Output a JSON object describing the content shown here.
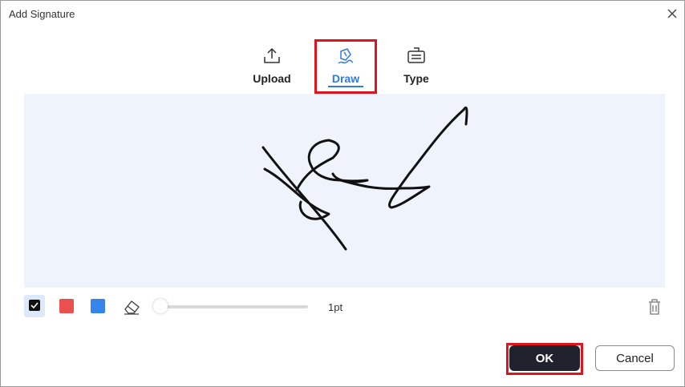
{
  "dialog": {
    "title": "Add Signature"
  },
  "tabs": [
    {
      "id": "upload",
      "label": "Upload",
      "icon": "upload-icon",
      "active": false
    },
    {
      "id": "draw",
      "label": "Draw",
      "icon": "draw-pen-icon",
      "active": true
    },
    {
      "id": "type",
      "label": "Type",
      "icon": "keyboard-icon",
      "active": false
    }
  ],
  "toolbar": {
    "colors": [
      {
        "name": "black",
        "hex": "#111111",
        "selected": true
      },
      {
        "name": "red",
        "hex": "#e9504f",
        "selected": false
      },
      {
        "name": "blue",
        "hex": "#3784ea",
        "selected": false
      }
    ],
    "stroke_size_label": "1pt",
    "stroke_size_fraction": 0.0
  },
  "buttons": {
    "ok_label": "OK",
    "cancel_label": "Cancel"
  },
  "colors": {
    "accent": "#2f7be4",
    "highlight": "#e0141e",
    "canvas_bg": "#eef3fc",
    "ok_bg": "#20222e"
  }
}
